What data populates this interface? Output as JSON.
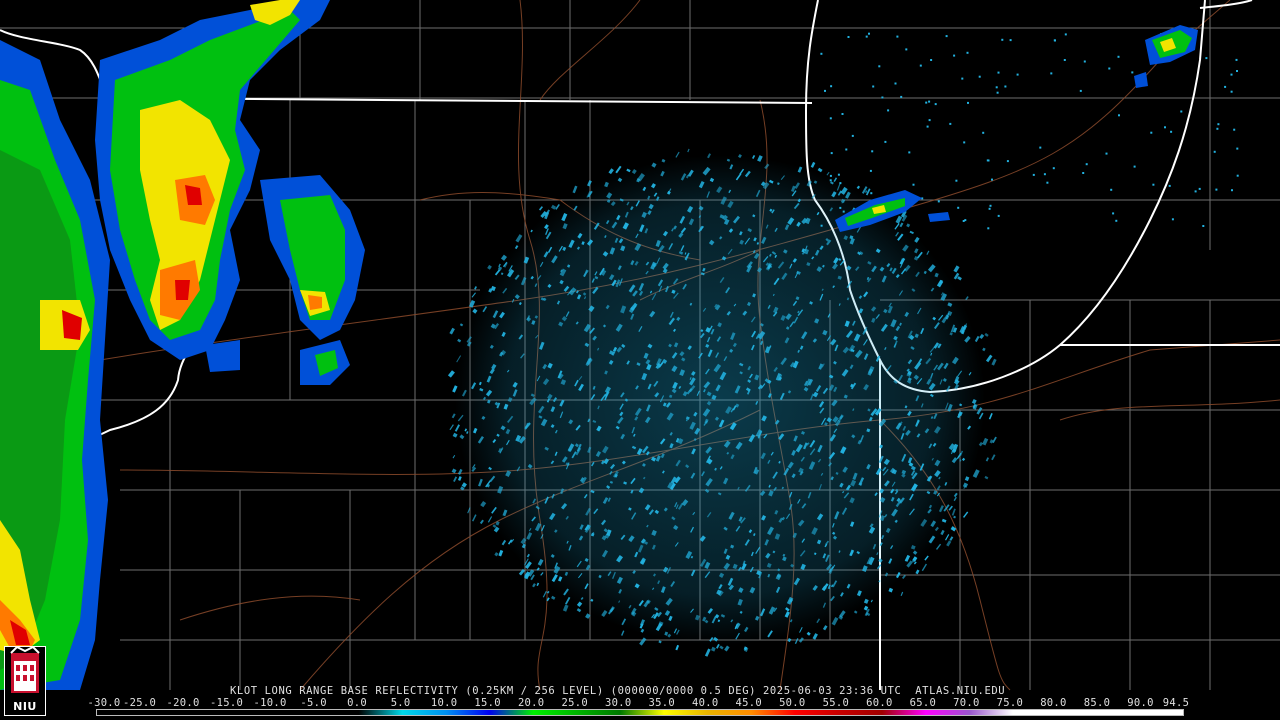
{
  "product": {
    "caption": "KLOT LONG RANGE BASE REFLECTIVITY (0.25KM / 256 LEVEL) (000000/0000 0.5 DEG) 2025-06-03 23:36 UTC  ATLAS.NIU.EDU"
  },
  "logo": {
    "text": "NIU",
    "colors": {
      "bg": "#000000",
      "fg": "#ffffff",
      "accent": "#c8102e"
    }
  },
  "legend": {
    "ticks": [
      "-30.0",
      "-25.0",
      "-20.0",
      "-15.0",
      "-10.0",
      "-5.0",
      "0.0",
      "5.0",
      "10.0",
      "15.0",
      "20.0",
      "25.0",
      "30.0",
      "35.0",
      "40.0",
      "45.0",
      "50.0",
      "55.0",
      "60.0",
      "65.0",
      "70.0",
      "75.0",
      "80.0",
      "85.0",
      "90.0",
      "94.5"
    ],
    "range": [
      -30,
      94.5
    ],
    "color_stops": [
      {
        "dbz": -30,
        "color": "#000000"
      },
      {
        "dbz": 0,
        "color": "#000000"
      },
      {
        "dbz": 5,
        "color": "#00d8e8"
      },
      {
        "dbz": 10,
        "color": "#0090f0"
      },
      {
        "dbz": 15,
        "color": "#0000f0"
      },
      {
        "dbz": 20,
        "color": "#00f000"
      },
      {
        "dbz": 25,
        "color": "#00b400"
      },
      {
        "dbz": 30,
        "color": "#007800"
      },
      {
        "dbz": 35,
        "color": "#ffff00"
      },
      {
        "dbz": 40,
        "color": "#e8b400"
      },
      {
        "dbz": 45,
        "color": "#ff8c00"
      },
      {
        "dbz": 50,
        "color": "#ff0000"
      },
      {
        "dbz": 55,
        "color": "#c80000"
      },
      {
        "dbz": 60,
        "color": "#a00000"
      },
      {
        "dbz": 65,
        "color": "#ff00ff"
      },
      {
        "dbz": 70,
        "color": "#9955cc"
      },
      {
        "dbz": 75,
        "color": "#ffffff"
      },
      {
        "dbz": 94.5,
        "color": "#ffffff"
      }
    ]
  },
  "map_style": {
    "background": "#000000",
    "state_border_color": "#ffffff",
    "county_line_color": "#7a7a7a",
    "road_color": "#8b4a2b"
  }
}
